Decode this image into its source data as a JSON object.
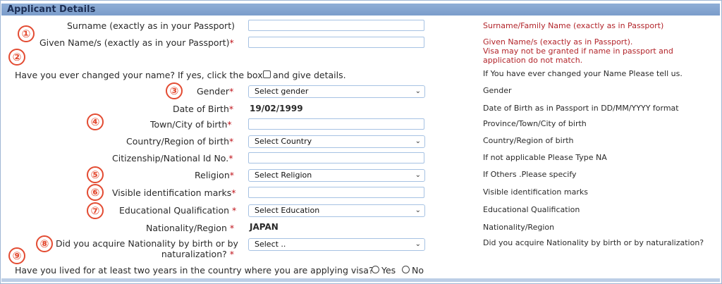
{
  "section_title": "Applicant Details",
  "badges": [
    "①",
    "②",
    "③",
    "④",
    "⑤",
    "⑥",
    "⑦",
    "⑧",
    "⑨"
  ],
  "fields": {
    "surname": {
      "label": "Surname (exactly as in your Passport)",
      "hint": "Surname/Family Name (exactly as in Passport)"
    },
    "given_name": {
      "label": "Given Name/s (exactly as in your Passport)",
      "hint1": "Given Name/s (exactly as in Passport).",
      "hint2": "Visa may not be granted if name in passport and",
      "hint3": "application do not match."
    },
    "changed_name": {
      "label_before": "Have you ever changed your name? If yes, click the box",
      "label_after": "and give details.",
      "hint": "If You have ever changed your Name Please tell us."
    },
    "gender": {
      "label": "Gender",
      "value": "Select gender",
      "hint": "Gender"
    },
    "dob": {
      "label": "Date of Birth",
      "value": "19/02/1999",
      "hint": "Date of Birth as in Passport in DD/MM/YYYY format"
    },
    "town": {
      "label": "Town/City of birth",
      "hint": "Province/Town/City of birth"
    },
    "country": {
      "label": "Country/Region of birth",
      "value": "Select Country",
      "hint": "Country/Region of birth"
    },
    "citizenship": {
      "label": "Citizenship/National Id No.",
      "hint": "If not applicable Please Type NA"
    },
    "religion": {
      "label": "Religion",
      "value": "Select Religion",
      "hint": "If Others .Please specify"
    },
    "marks": {
      "label": "Visible identification marks",
      "hint": "Visible identification marks"
    },
    "education": {
      "label": "Educational Qualification ",
      "value": "Select Education",
      "hint": "Educational Qualification"
    },
    "nationality": {
      "label": "Nationality/Region ",
      "value": "JAPAN",
      "hint": "Nationality/Region"
    },
    "acquire": {
      "label1": "Did you acquire Nationality by birth or by",
      "label2": "naturalization? ",
      "value": "Select ..",
      "hint": "Did you acquire Nationality by birth or by naturalization?"
    },
    "lived": {
      "label": "Have you lived for at least two years in the country where you are applying visa?",
      "yes": "Yes",
      "no": "No"
    }
  },
  "required_mark": "*",
  "chevron": "⌄"
}
